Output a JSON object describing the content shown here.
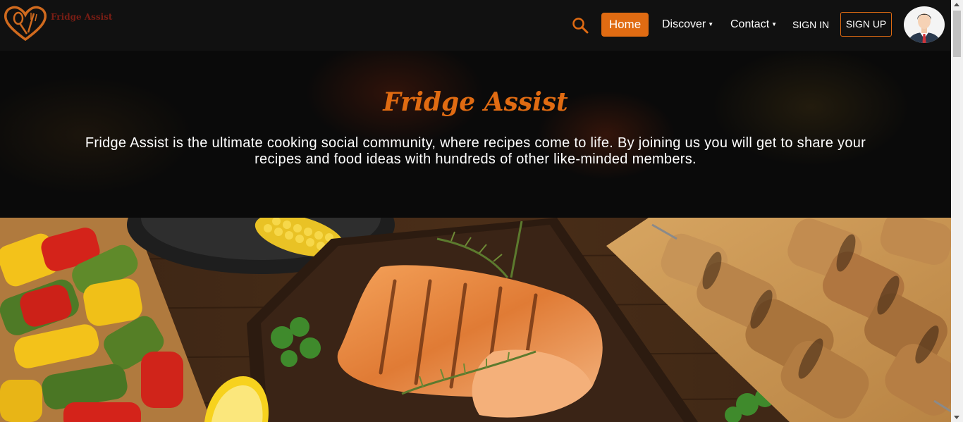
{
  "brand": {
    "logo_text": "Fridge Assist"
  },
  "nav": {
    "home_label": "Home",
    "discover_label": "Discover",
    "contact_label": "Contact",
    "signin_label": "SIGN IN",
    "signup_label": "SIGN UP",
    "search_icon": "search-icon",
    "caret_icon": "caret-down-icon",
    "avatar_icon": "user-avatar"
  },
  "hero": {
    "title": "Fridge Assist",
    "description": "Fridge Assist is the ultimate cooking social community, where recipes come to life. By joining us you will get to share your recipes and food ideas with hundreds of other like-minded members."
  },
  "colors": {
    "accent": "#e06b12",
    "navbar_bg": "#111111",
    "text": "#ffffff",
    "logo_text": "#7a1d14"
  }
}
